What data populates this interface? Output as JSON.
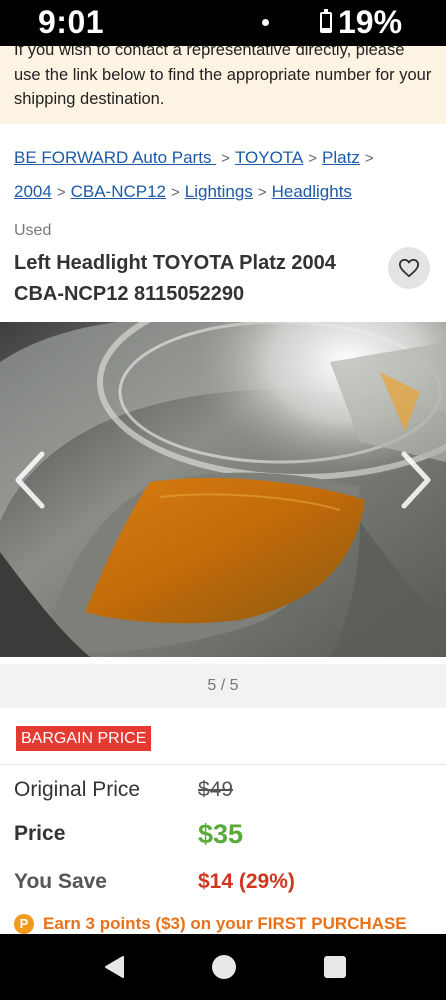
{
  "status_bar": {
    "time": "9:01",
    "battery": "19%",
    "battery_level": 0.19
  },
  "notice": {
    "text": "If you wish to contact a representative directly, please use the link below to find the appropriate number for your shipping destination."
  },
  "breadcrumb": {
    "items": [
      "BE FORWARD Auto Parts ",
      "TOYOTA",
      "Platz",
      "2004",
      "CBA-NCP12",
      "Lightings",
      "Headlights"
    ],
    "separator": ">"
  },
  "product": {
    "condition": "Used",
    "title": "Left Headlight TOYOTA Platz 2004 CBA-NCP12 8115052290"
  },
  "gallery": {
    "counter": "5 / 5"
  },
  "pricing": {
    "badge": "BARGAIN PRICE",
    "original_label": "Original Price",
    "original_value": "$49",
    "price_label": "Price",
    "price_value": "$35",
    "save_label": "You Save",
    "save_value": "$14 (29%)",
    "points_icon": "P",
    "points_text": "Earn 3 points ($3) on your FIRST PURCHASE"
  },
  "colors": {
    "link": "#1d5aa8",
    "badge": "#e53a32",
    "price": "#5aaa37",
    "save": "#d0351e",
    "points": "#e8711a",
    "notice_bg": "#fdf3e2"
  }
}
